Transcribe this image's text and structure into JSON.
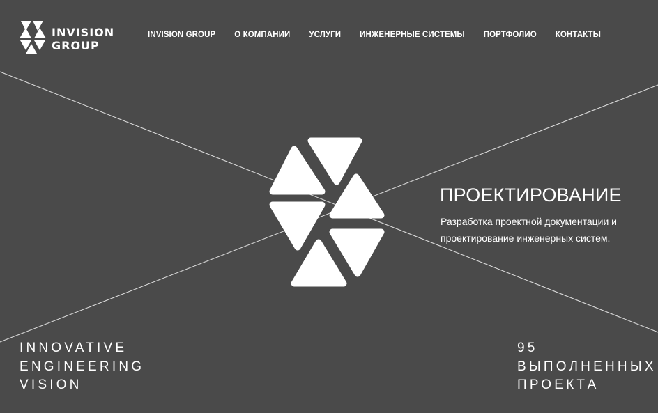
{
  "logo": {
    "line1": "INVISION",
    "line2": "GROUP"
  },
  "nav": {
    "items": [
      {
        "label": "INVISION GROUP"
      },
      {
        "label": "О КОМПАНИИ"
      },
      {
        "label": "УСЛУГИ"
      },
      {
        "label": "ИНЖЕНЕРНЫЕ СИСТЕМЫ"
      },
      {
        "label": "ПОРТФОЛИО"
      },
      {
        "label": "КОНТАКТЫ"
      }
    ]
  },
  "hero": {
    "title": "ПРОЕКТИРОВАНИЕ",
    "description": "Разработка проектной документации и проектирование инженерных систем."
  },
  "tagline": {
    "line1": "INNOVATIVE",
    "line2": "ENGINEERING",
    "line3": "VISION"
  },
  "stats": {
    "count": "95",
    "line1": "ВЫПОЛНЕННЫХ",
    "line2": "ПРОЕКТА"
  },
  "colors": {
    "background": "#4a4a4a",
    "foreground": "#ffffff",
    "lines": "#d8d8d8"
  }
}
